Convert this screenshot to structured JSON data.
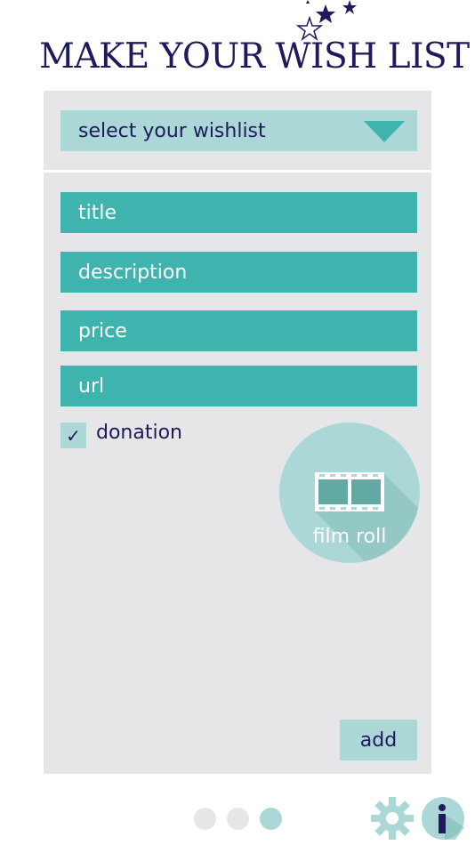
{
  "header": {
    "title": "MAKE YOUR WISH LIST"
  },
  "wishlist_select": {
    "label": "select your wishlist"
  },
  "fields": {
    "title_placeholder": "title",
    "description_placeholder": "description",
    "price_placeholder": "price",
    "url_placeholder": "url"
  },
  "donation": {
    "label": "donation",
    "checked": true,
    "check_mark": "✓"
  },
  "film_roll": {
    "label": "film roll",
    "icon": "film-strip-icon"
  },
  "add_button": {
    "label": "add"
  },
  "pagination": {
    "count": 3,
    "active_index": 2
  },
  "toolbar": {
    "settings_icon": "gear-icon",
    "info_icon": "info-icon"
  },
  "colors": {
    "navy": "#1f1a5c",
    "teal": "#3fb3ad",
    "light_teal": "#abd8d6",
    "panel_gray": "#e6e6e9",
    "white": "#ffffff"
  }
}
